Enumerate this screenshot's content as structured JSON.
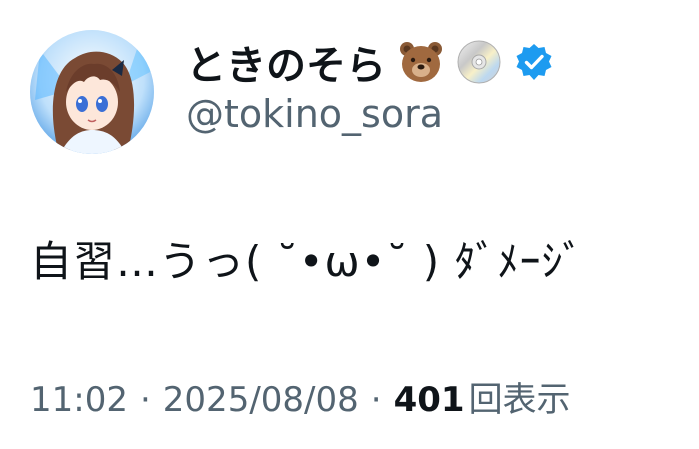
{
  "author": {
    "display_name": "ときのそら",
    "handle": "@tokino_sora",
    "name_emojis": [
      "bear-emoji",
      "dvd-emoji"
    ],
    "verified": true,
    "verified_color": "#1d9bf0"
  },
  "tweet": {
    "text": "自習…うっ( ˘•ω•˘ ) ﾀﾞﾒｰｼﾞ"
  },
  "meta": {
    "time": "11:02",
    "separator": "·",
    "date": "2025/08/08",
    "views_count": "401",
    "views_label": "回表示"
  },
  "colors": {
    "text_primary": "#0f1419",
    "text_secondary": "#536471",
    "background": "#ffffff"
  }
}
